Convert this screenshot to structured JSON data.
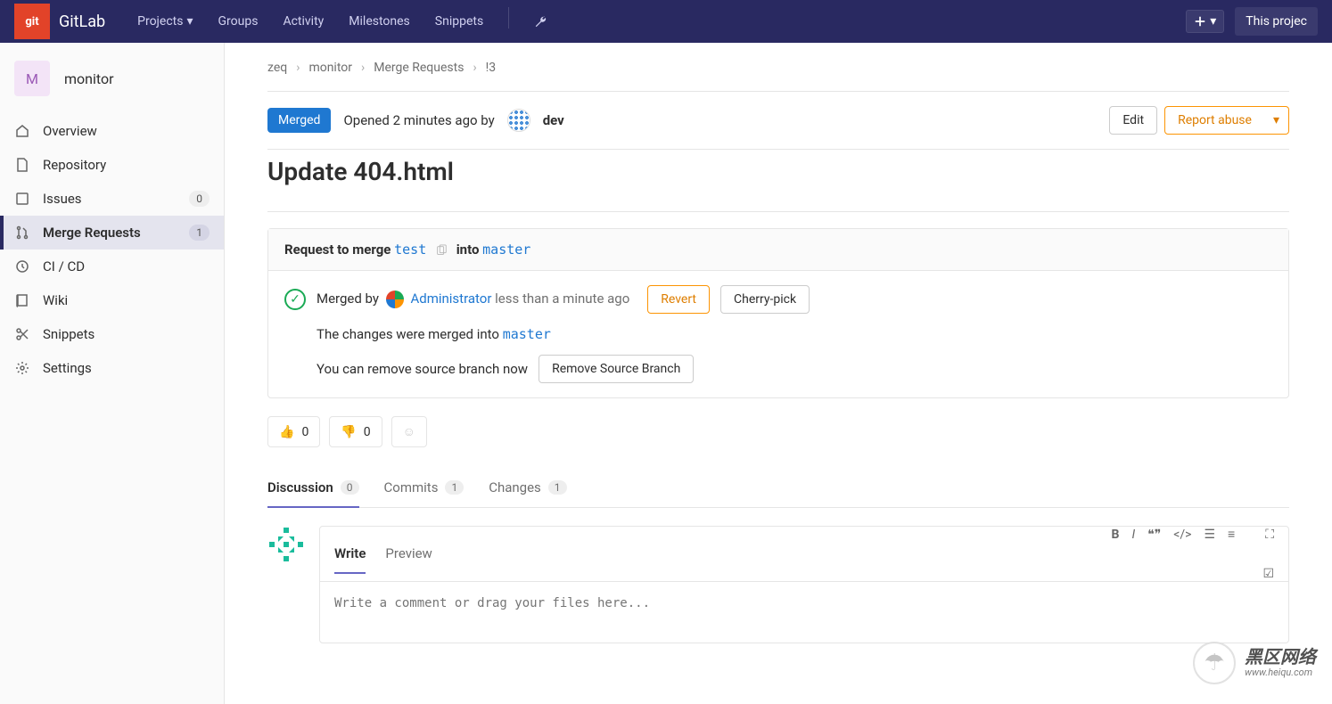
{
  "brand": "GitLab",
  "logo_text": "git",
  "topnav": {
    "projects": "Projects",
    "groups": "Groups",
    "activity": "Activity",
    "milestones": "Milestones",
    "snippets": "Snippets",
    "search_placeholder": "This projec"
  },
  "project": {
    "avatar_letter": "M",
    "name": "monitor"
  },
  "sidebar": {
    "overview": "Overview",
    "repository": "Repository",
    "issues": "Issues",
    "issues_count": "0",
    "merge_requests": "Merge Requests",
    "mr_count": "1",
    "cicd": "CI / CD",
    "wiki": "Wiki",
    "snippets": "Snippets",
    "settings": "Settings"
  },
  "breadcrumb": {
    "group": "zeq",
    "project": "monitor",
    "section": "Merge Requests",
    "id": "!3"
  },
  "mr": {
    "status": "Merged",
    "opened_prefix": "Opened ",
    "opened_time": "2 minutes ago",
    "opened_by": " by ",
    "author": "dev",
    "edit": "Edit",
    "report_abuse": "Report abuse",
    "title": "Update 404.html"
  },
  "merge_box": {
    "request_text": "Request to merge ",
    "source_branch": "test",
    "into": " into ",
    "target_branch": "master",
    "merged_by": "Merged by ",
    "admin": "Administrator",
    "merged_time": " less than a minute ago",
    "revert": "Revert",
    "cherry_pick": "Cherry-pick",
    "changes_merged": "The changes were merged into ",
    "changes_target": "master",
    "remove_hint": "You can remove source branch now",
    "remove_btn": "Remove Source Branch"
  },
  "reactions": {
    "up_count": "0",
    "down_count": "0"
  },
  "tabs": {
    "discussion": "Discussion",
    "discussion_count": "0",
    "commits": "Commits",
    "commits_count": "1",
    "changes": "Changes",
    "changes_count": "1"
  },
  "comment": {
    "write": "Write",
    "preview": "Preview",
    "placeholder": "Write a comment or drag your files here..."
  },
  "watermark": {
    "title": "黑区网络",
    "url": "www.heiqu.com"
  }
}
